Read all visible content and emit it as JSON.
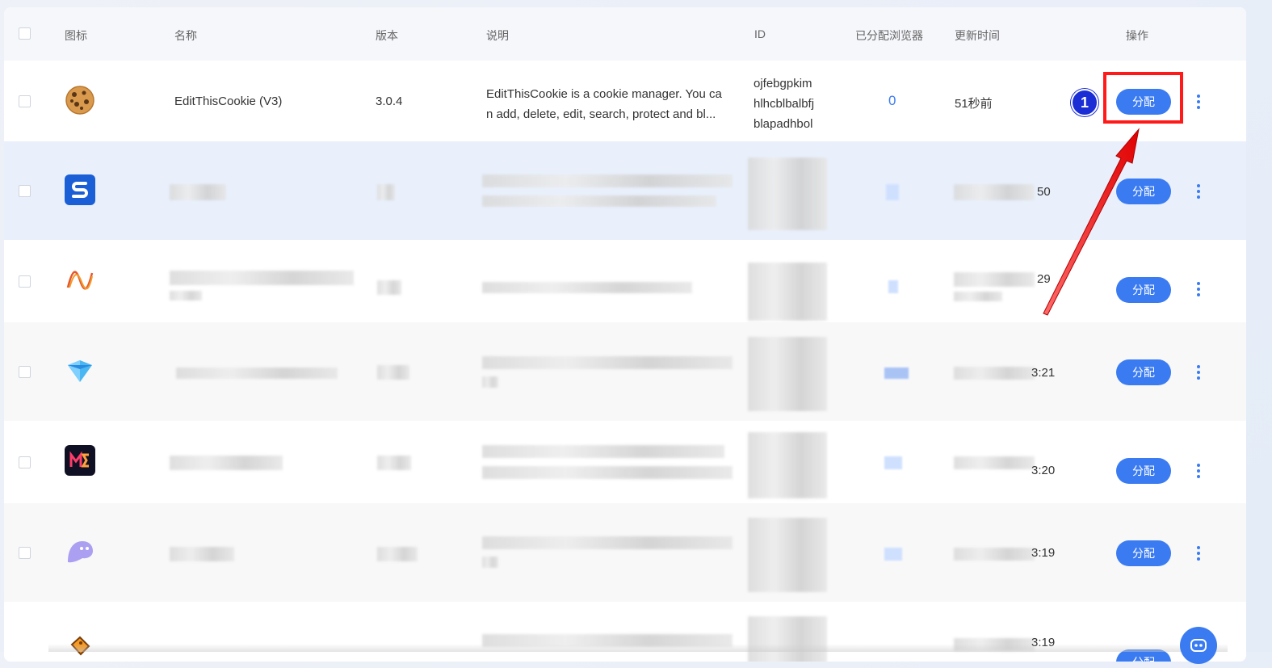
{
  "header": {
    "icon": "图标",
    "name": "名称",
    "version": "版本",
    "description": "说明",
    "id": "ID",
    "assigned_browsers": "已分配浏览器",
    "updated": "更新时间",
    "actions": "操作"
  },
  "rows": [
    {
      "icon": "cookie-icon",
      "name": "EditThisCookie (V3)",
      "version": "3.0.4",
      "description_line1": "EditThisCookie is a cookie manager. You ca",
      "description_line2": "n add, delete, edit, search, protect and bl...",
      "id_line1": "ojfebgpkim",
      "id_line2": "hlhcblbalbfj",
      "id_line3": "blapadhbol",
      "assigned": "0",
      "updated": "51秒前",
      "assign_label": "分配"
    },
    {
      "icon": "blue-s-icon",
      "updated_tail": "50",
      "assign_label": "分配"
    },
    {
      "icon": "wave-icon",
      "updated_tail": "29",
      "assign_label": "分配"
    },
    {
      "icon": "diamond-icon",
      "updated_tail": "3:21",
      "assign_label": "分配"
    },
    {
      "icon": "me-logo-icon",
      "updated_tail": "3:20",
      "assign_label": "分配"
    },
    {
      "icon": "ghost-icon",
      "updated_tail": "3:19",
      "assign_label": "分配"
    },
    {
      "icon": "tag-icon",
      "updated_tail": "3:19",
      "assign_label": "分配"
    }
  ],
  "annotation": {
    "badge": "1"
  },
  "colors": {
    "accent": "#3a7bf2",
    "annotation": "#ff1a1a",
    "badge": "#1b2ed6"
  }
}
